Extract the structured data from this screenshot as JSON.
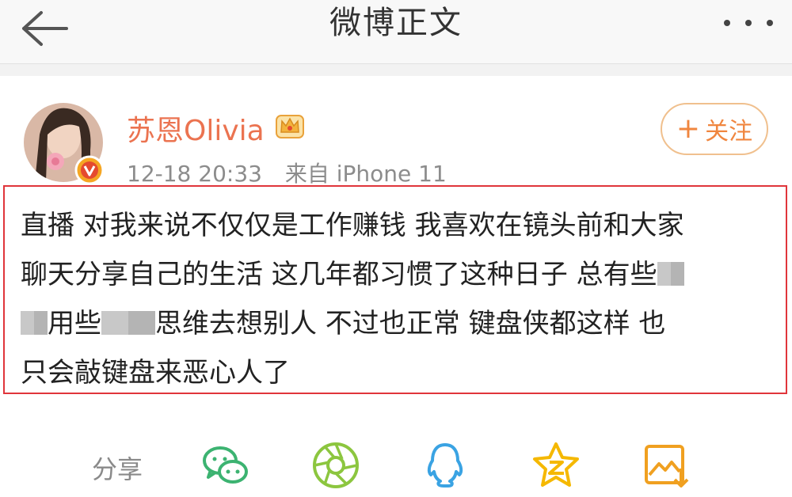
{
  "header": {
    "title": "微博正文",
    "back_icon": "back-arrow-icon",
    "more_icon": "more-dots-icon"
  },
  "post": {
    "author_name": "苏恩Olivia",
    "time": "12-18 20:33",
    "source": "来自 iPhone 11",
    "follow_label": "关注",
    "text": {
      "line1": "直播 对我来说不仅仅是工作赚钱 我喜欢在镜头前和大家",
      "line2": "聊天分享自己的生活 这几年都习惯了这种日子 总有些",
      "line3a": "用些",
      "line3b": "思维去想别人 不过也正常 键盘侠都这样 也",
      "line4": "只会敲键盘来恶心人了"
    }
  },
  "share": {
    "label": "分享",
    "icons": [
      "wechat-icon",
      "moments-icon",
      "qq-icon",
      "qzone-icon",
      "save-image-icon"
    ]
  },
  "colors": {
    "accent": "#eb7350",
    "follow": "#f0863f",
    "highlight_border": "#e0353b",
    "wechat": "#3cb371",
    "moments": "#8cc63f",
    "qq": "#3aa3e3",
    "qzone": "#f5b800",
    "save": "#f0a020"
  }
}
